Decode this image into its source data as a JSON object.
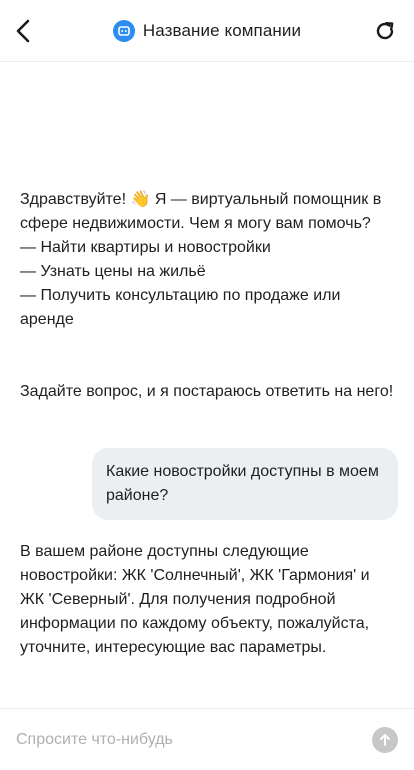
{
  "header": {
    "title": "Название компании",
    "back_icon": "chevron-left-icon",
    "logo_icon": "bot-icon",
    "refresh_icon": "refresh-icon"
  },
  "messages": {
    "bot_greeting": {
      "line1": "Здравствуйте! 👋 Я — виртуальный помощник в сфере недвижимости. Чем я могу вам помочь?",
      "item1": "— Найти квартиры и новостройки",
      "item2": "— Узнать цены на жильё",
      "item3": "— Получить консультацию по продаже или аренде",
      "closing": "Задайте вопрос, и я постараюсь ответить на него!"
    },
    "user_question": "Какие новостройки доступны в моем районе?",
    "bot_answer": "В вашем районе доступны следующие новостройки: ЖК 'Солнечный', ЖК 'Гармония' и ЖК 'Северный'. Для получения подробной информации по каждому объекту, пожалуйста, уточните, интересующие вас параметры."
  },
  "input": {
    "placeholder": "Спросите что-нибудь",
    "value": "",
    "send_icon": "arrow-up-icon"
  },
  "colors": {
    "accent": "#2d8cf0",
    "user_bubble": "#eceff1",
    "send_disabled": "#c7c7c7",
    "placeholder": "#b0b0b0"
  }
}
